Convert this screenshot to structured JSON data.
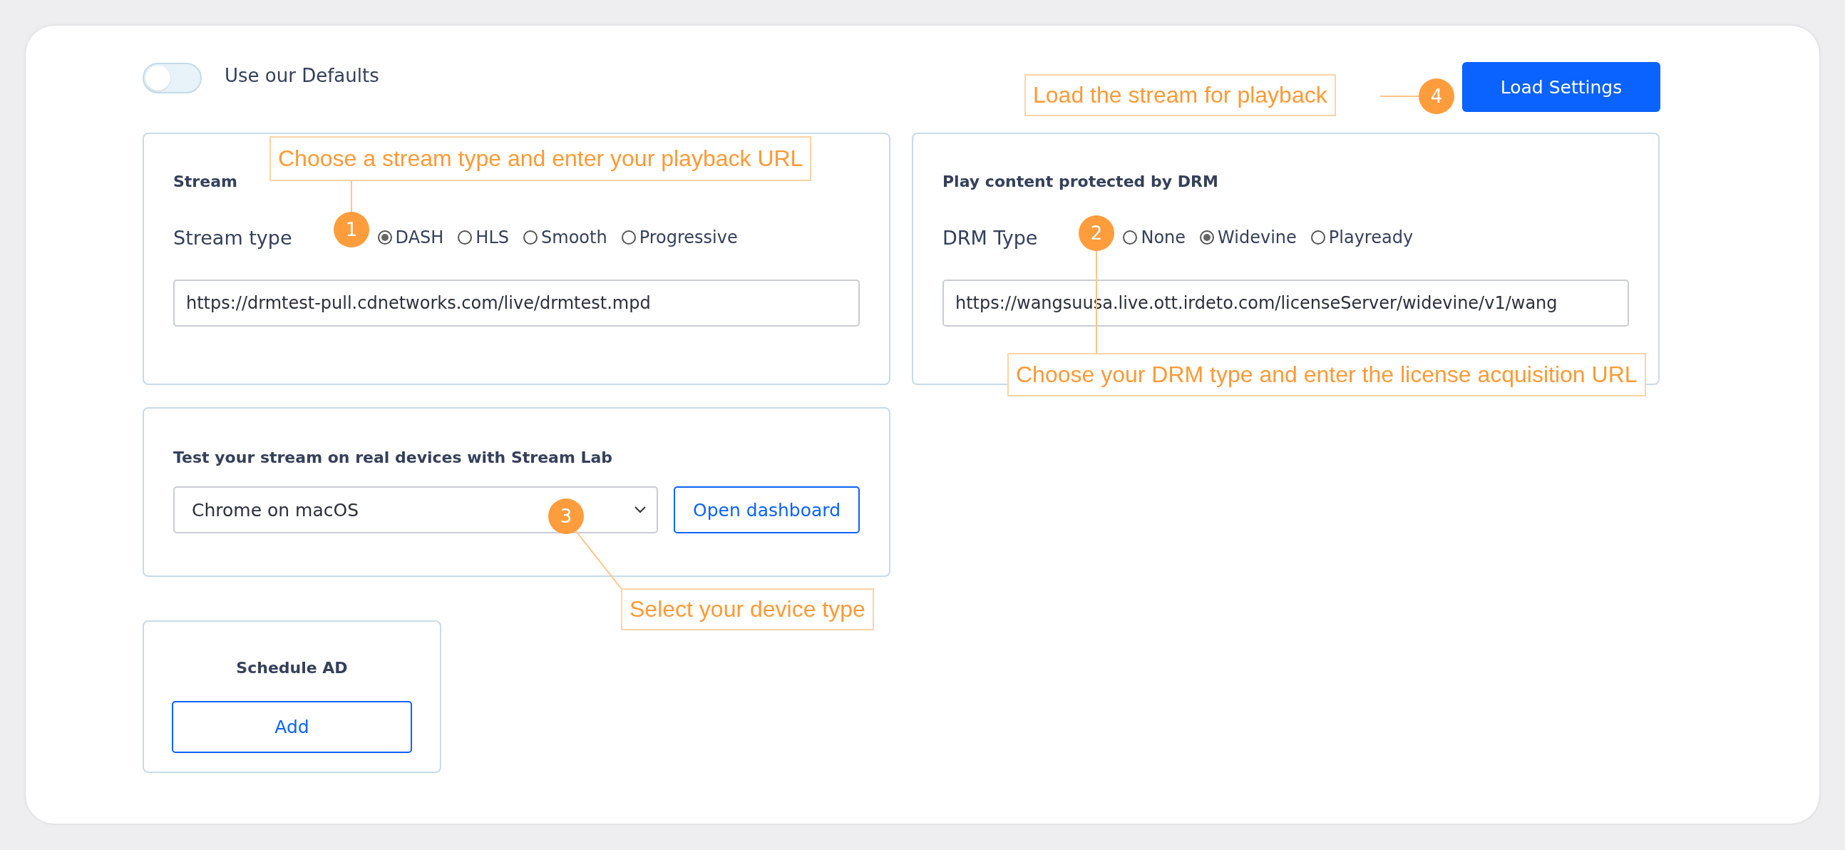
{
  "top_bar": {
    "defaults_toggle": {
      "label": "Use our Defaults",
      "on": false
    },
    "load_button": "Load Settings"
  },
  "stream_panel": {
    "title": "Stream",
    "type_label": "Stream type",
    "options": [
      {
        "label": "DASH",
        "selected": true
      },
      {
        "label": "HLS",
        "selected": false
      },
      {
        "label": "Smooth",
        "selected": false
      },
      {
        "label": "Progressive",
        "selected": false
      }
    ],
    "url": "https://drmtest-pull.cdnetworks.com/live/drmtest.mpd"
  },
  "drm_panel": {
    "title": "Play content protected by DRM",
    "type_label": "DRM Type",
    "options": [
      {
        "label": "None",
        "selected": false
      },
      {
        "label": "Widevine",
        "selected": true
      },
      {
        "label": "Playready",
        "selected": false
      }
    ],
    "url": "https://wangsuusa.live.ott.irdeto.com/licenseServer/widevine/v1/wang"
  },
  "device_panel": {
    "title": "Test your stream on real devices with Stream Lab",
    "device": "Chrome on macOS",
    "button": "Open dashboard"
  },
  "ad_panel": {
    "title": "Schedule AD",
    "button": "Add"
  },
  "annotations": [
    {
      "number": "1",
      "text": "Choose a stream type and enter your playback URL"
    },
    {
      "number": "2",
      "text": "Choose your DRM type and enter the license acquisition URL"
    },
    {
      "number": "3",
      "text": "Select your device type"
    },
    {
      "number": "4",
      "text": "Load the stream for playback"
    }
  ]
}
